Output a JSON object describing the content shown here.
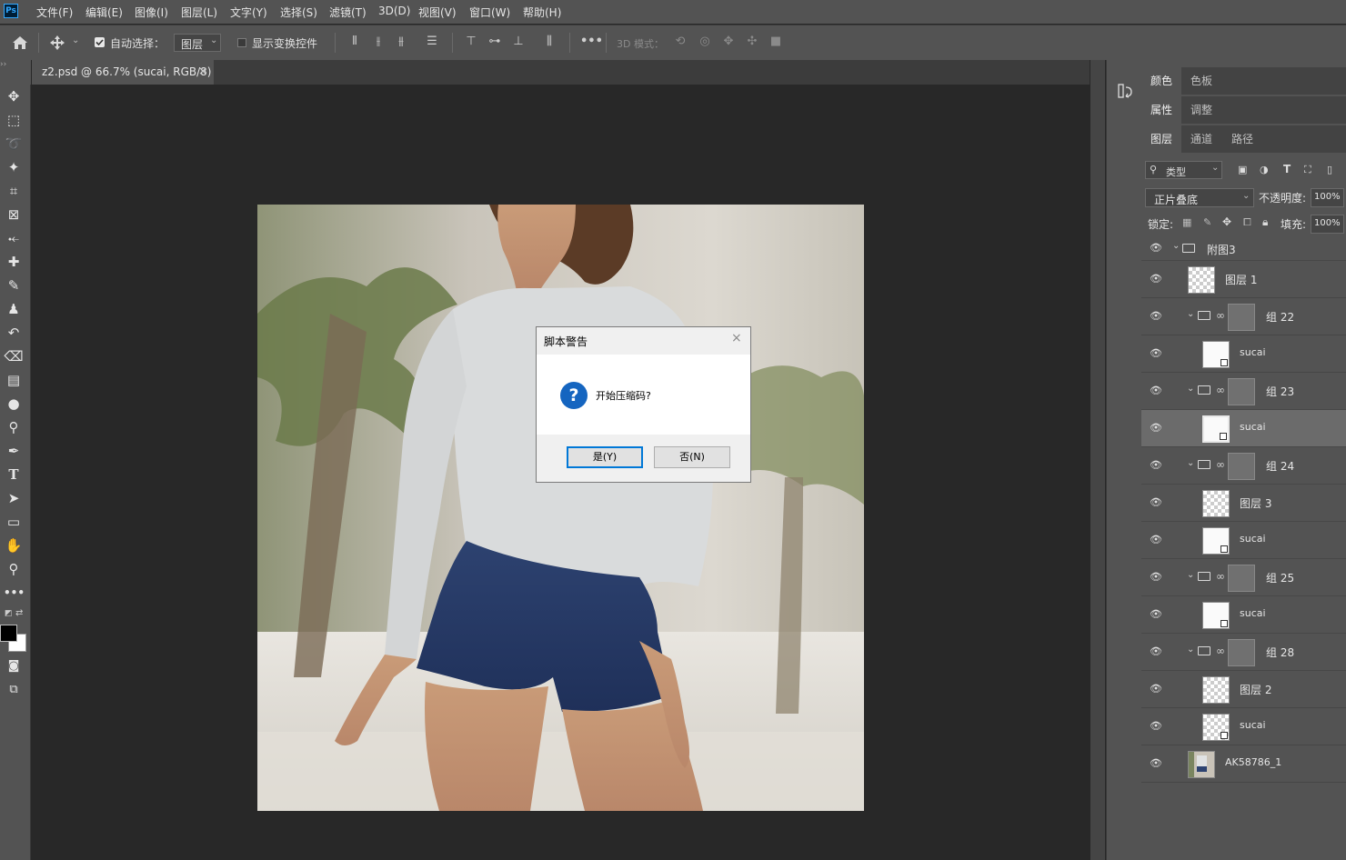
{
  "app": {
    "logo": "Ps"
  },
  "menu": [
    "文件(F)",
    "编辑(E)",
    "图像(I)",
    "图层(L)",
    "文字(Y)",
    "选择(S)",
    "滤镜(T)",
    "3D(D)",
    "视图(V)",
    "窗口(W)",
    "帮助(H)"
  ],
  "options": {
    "auto_select_label": "自动选择：",
    "auto_select_value": "图层",
    "show_transform_label": "显示变换控件",
    "mode_3d_label": "3D 模式："
  },
  "document": {
    "tab_title": "z2.psd @ 66.7% (sucai, RGB/8)",
    "close_glyph": "×"
  },
  "panels": {
    "row1": [
      "颜色",
      "色板"
    ],
    "row2": [
      "属性",
      "调整"
    ],
    "row3": [
      "图层",
      "通道",
      "路径"
    ]
  },
  "layers_panel": {
    "filter_label": "类型",
    "blend_mode": "正片叠底",
    "opacity_label": "不透明度:",
    "opacity_value": "100%",
    "lock_label": "锁定:",
    "fill_label": "填充:",
    "fill_value": "100%",
    "layers": [
      {
        "name": "附图3",
        "type": "group-root"
      },
      {
        "name": "图层 1",
        "type": "layer"
      },
      {
        "name": "组 22",
        "type": "group"
      },
      {
        "name": "sucai",
        "type": "smart"
      },
      {
        "name": "组 23",
        "type": "group"
      },
      {
        "name": "sucai",
        "type": "smart",
        "selected": true
      },
      {
        "name": "组 24",
        "type": "group"
      },
      {
        "name": "图层 3",
        "type": "layer"
      },
      {
        "name": "sucai",
        "type": "smart"
      },
      {
        "name": "组 25",
        "type": "group"
      },
      {
        "name": "sucai",
        "type": "smart"
      },
      {
        "name": "组 28",
        "type": "group"
      },
      {
        "name": "图层 2",
        "type": "layer"
      },
      {
        "name": "sucai",
        "type": "smart"
      },
      {
        "name": "AK58786_1",
        "type": "image"
      }
    ]
  },
  "dialog": {
    "title": "脚本警告",
    "message": "开始压缩码?",
    "yes_label": "是(Y)",
    "no_label": "否(N)",
    "close_glyph": "×",
    "icon_glyph": "?"
  },
  "colors": {
    "accent": "#31a8ff",
    "dialog_icon": "#1565c0",
    "default_button_border": "#0078d7"
  }
}
